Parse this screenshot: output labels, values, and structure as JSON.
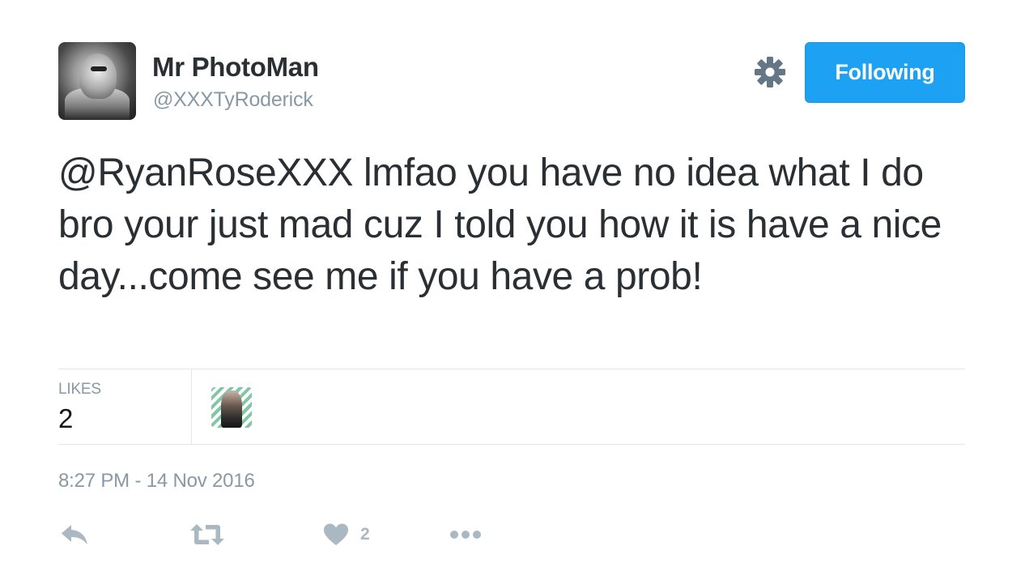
{
  "user": {
    "display_name": "Mr PhotoMan",
    "handle": "@XXXTyRoderick",
    "avatar_icon": "profile-photo"
  },
  "header": {
    "settings_icon": "gear-icon",
    "follow_button_label": "Following",
    "follow_button_color": "#1da1f2"
  },
  "tweet": {
    "mention": "@RyanRoseXXX",
    "text": " lmfao you have no idea what I do bro your just mad cuz I told you how it is have a nice day...come see me if you have a prob!"
  },
  "stats": {
    "likes_label": "LIKES",
    "likes_count": "2"
  },
  "timestamp": "8:27 PM - 14 Nov 2016",
  "actions": {
    "reply_icon": "reply-icon",
    "retweet_icon": "retweet-icon",
    "like_icon": "heart-icon",
    "like_count": "2",
    "more_icon": "more-icon"
  },
  "colors": {
    "text": "#292f33",
    "muted": "#8899a6",
    "action_gray": "#aab8c2",
    "divider": "#e1e8ed"
  }
}
